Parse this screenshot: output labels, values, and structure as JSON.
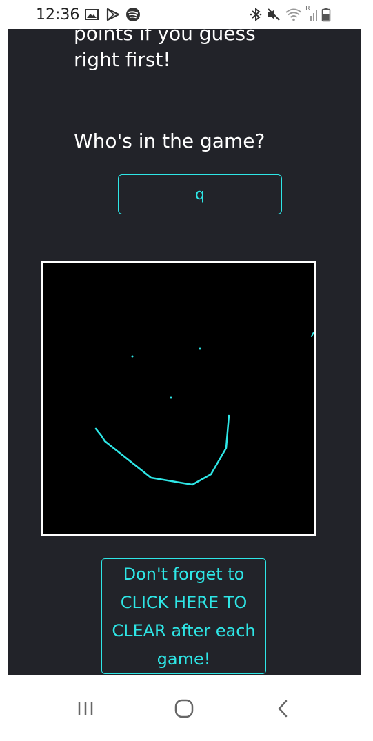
{
  "status_bar": {
    "time": "12:36",
    "left_icons": [
      "image-icon",
      "play-store-icon",
      "spotify-icon"
    ],
    "right_icons": [
      "bluetooth-icon",
      "mute-icon",
      "wifi-icon",
      "signal-icon",
      "battery-icon"
    ],
    "signal_roaming_label": "R"
  },
  "page": {
    "intro_line1": "points if you guess",
    "intro_line2": "right first!",
    "question": "Who's in the game?",
    "player_input_value": "q",
    "clear_button_label": "Don't forget to CLICK HERE TO CLEAR after each game!"
  },
  "canvas": {
    "stroke_color": "#2ee6e6"
  },
  "nav_bar": {
    "buttons": [
      "recent-apps",
      "home",
      "back"
    ]
  },
  "colors": {
    "page_background": "#222329",
    "accent": "#2ee6e6",
    "canvas_background": "#000000",
    "canvas_border": "#ffffff"
  }
}
